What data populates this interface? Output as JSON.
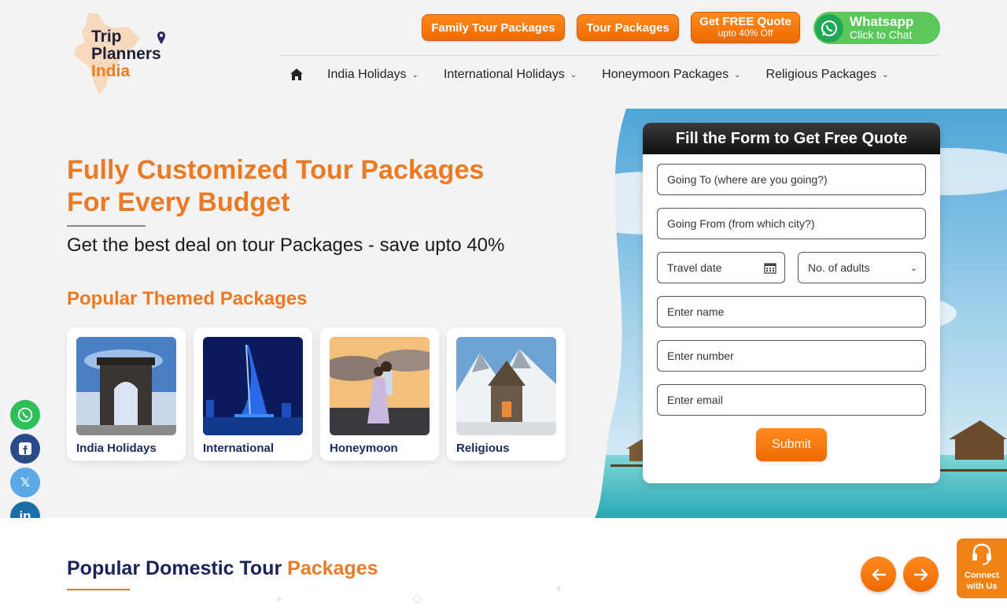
{
  "brand": {
    "line1": "Trip",
    "line2": "Planners",
    "line3": "India"
  },
  "top_buttons": {
    "family": "Family Tour Packages",
    "tour": "Tour Packages",
    "quote_main": "Get FREE Quote",
    "quote_sub": "upto 40% Off",
    "whatsapp_title": "Whatsapp",
    "whatsapp_sub": "Click to Chat"
  },
  "nav": {
    "items": [
      "India Holidays",
      "International Holidays",
      "Honeymoon Packages",
      "Religious Packages"
    ]
  },
  "hero": {
    "headline_line1": "Fully Customized Tour Packages",
    "headline_line2": "For Every Budget",
    "subline": "Get the best deal on tour Packages - save upto 40%",
    "themed_title": "Popular Themed Packages",
    "cards": [
      "India Holidays",
      "International",
      "Honeymoon",
      "Religious"
    ]
  },
  "form": {
    "title": "Fill the Form to Get Free Quote",
    "going_to": "Going To (where are you going?)",
    "going_from": "Going From (from which city?)",
    "travel_date": "Travel date",
    "adults": "No. of adults",
    "name": "Enter name",
    "number": "Enter number",
    "email": "Enter email",
    "submit": "Submit"
  },
  "domestic": {
    "title_main": "Popular Domestic Tour ",
    "title_accent": "Packages"
  },
  "connect": {
    "line1": "Connect",
    "line2": "with Us"
  },
  "colors": {
    "accent": "#ec7a24",
    "navy": "#1b2257",
    "whatsapp": "#5ac85a"
  }
}
